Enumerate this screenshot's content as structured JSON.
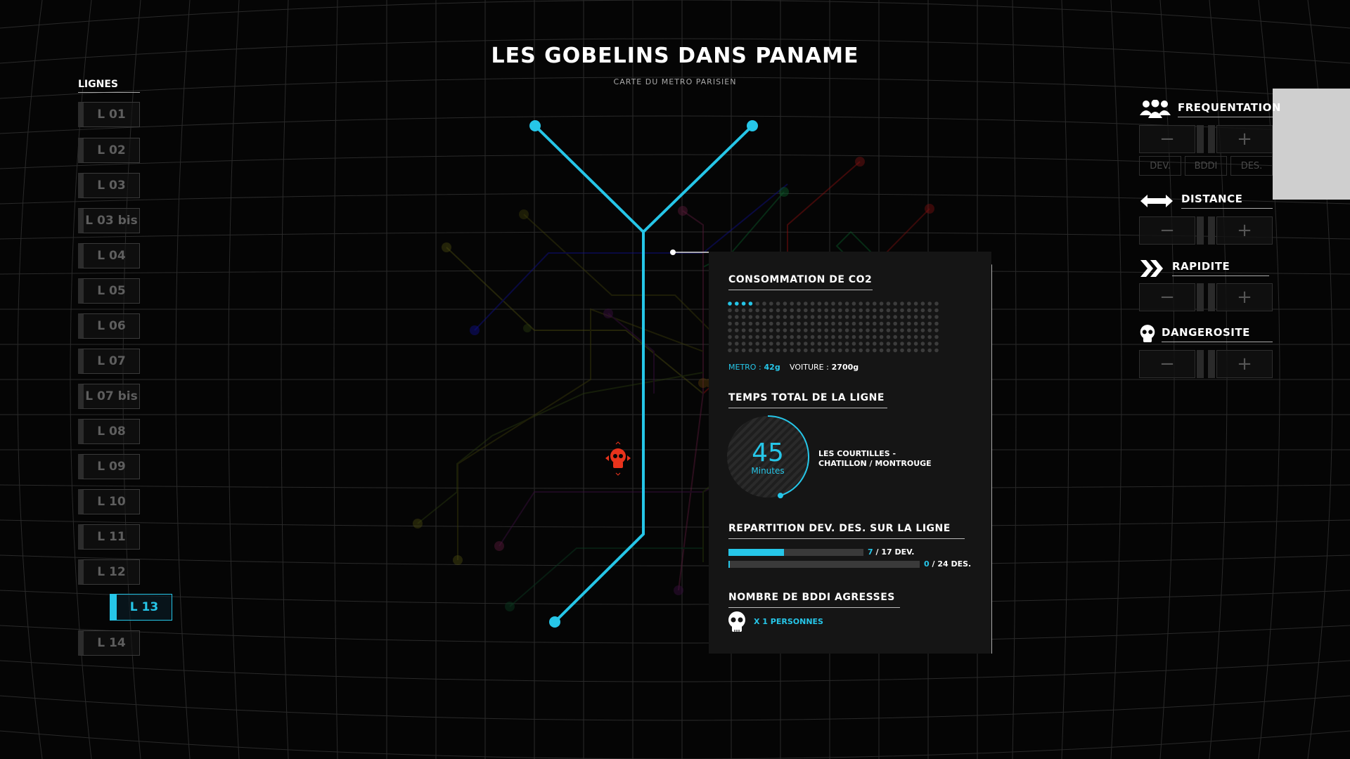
{
  "header": {
    "title": "LES GOBELINS DANS PANAME",
    "subtitle": "CARTE DU METRO PARISIEN"
  },
  "lines": {
    "heading": "LIGNES",
    "items": [
      "L 01",
      "L 02",
      "L 03",
      "L 03 bis",
      "L 04",
      "L 05",
      "L 06",
      "L 07",
      "L 07 bis",
      "L 08",
      "L 09",
      "L 10",
      "L 11",
      "L 12",
      "L 13",
      "L 14"
    ],
    "active": "L 13"
  },
  "panel": {
    "co2": {
      "title": "CONSOMMATION DE CO2",
      "metro_label": "METRO :",
      "metro_value": "42g",
      "voiture_label": "VOITURE :",
      "voiture_value": "2700g",
      "dots_filled": 4
    },
    "time": {
      "title": "TEMPS TOTAL DE LA LIGNE",
      "value": "45",
      "unit": "Minutes",
      "route_line1": "LES COURTILLES -",
      "route_line2": "CHATILLON / MONTROUGE",
      "fraction": 0.45
    },
    "repartition": {
      "title": "REPARTITION DEV. DES. SUR LA LIGNE",
      "dev": {
        "count": "7",
        "rest": "/ 17 DEV.",
        "fraction": 0.41
      },
      "des": {
        "count": "0",
        "rest": "/ 24 DES.",
        "fraction": 0.0
      }
    },
    "bddi": {
      "title": "NOMBRE DE BDDI AGRESSES",
      "value": "X 1 PERSONNES"
    }
  },
  "filters": {
    "frequentation": {
      "label": "FREQUENTATION",
      "tags": [
        "DEV.",
        "BDDI",
        "DES."
      ]
    },
    "distance": {
      "label": "DISTANCE"
    },
    "rapidite": {
      "label": "RAPIDITE"
    },
    "dangerosite": {
      "label": "DANGEROSITE"
    },
    "minus": "−",
    "plus": "+"
  },
  "colors": {
    "accent": "#26c6e8",
    "danger": "#e8331c",
    "panel": "#151515"
  }
}
